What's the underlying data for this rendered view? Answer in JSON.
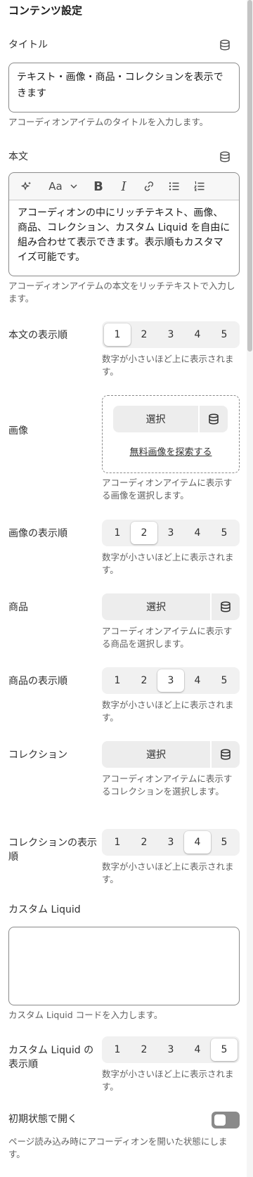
{
  "section_title": "コンテンツ設定",
  "title_field": {
    "label": "タイトル",
    "value": "テキスト・画像・商品・コレクションを表示できます",
    "help": "アコーディオンアイテムのタイトルを入力します。"
  },
  "body_field": {
    "label": "本文",
    "toolbar": {
      "font_label": "Aa",
      "bold": "B",
      "italic": "I"
    },
    "value": "アコーディオンの中にリッチテキスト、画像、商品、コレクション、カスタム Liquid を自由に組み合わせて表示できます。表示順もカスタマイズ可能です。",
    "help": "アコーディオンアイテムの本文をリッチテキストで入力します。"
  },
  "order_options": [
    "1",
    "2",
    "3",
    "4",
    "5"
  ],
  "order_help": "数字が小さいほど上に表示されます。",
  "body_order": {
    "label": "本文の表示順",
    "selected": "1"
  },
  "image": {
    "label": "画像",
    "select_label": "選択",
    "explore_link": "無料画像を探索する",
    "help": "アコーディオンアイテムに表示する画像を選択します。"
  },
  "image_order": {
    "label": "画像の表示順",
    "selected": "2"
  },
  "product": {
    "label": "商品",
    "select_label": "選択",
    "help": "アコーディオンアイテムに表示する商品を選択します。"
  },
  "product_order": {
    "label": "商品の表示順",
    "selected": "3"
  },
  "collection": {
    "label": "コレクション",
    "select_label": "選択",
    "help": "アコーディオンアイテムに表示するコレクションを選択します。"
  },
  "collection_order": {
    "label": "コレクションの表示順",
    "selected": "4"
  },
  "custom_liquid": {
    "label": "カスタム Liquid",
    "value": "",
    "help": "カスタム Liquid コードを入力します。"
  },
  "liquid_order": {
    "label": "カスタム Liquid の表示順",
    "selected": "5"
  },
  "open_default": {
    "label": "初期状態で開く",
    "checked": false,
    "help": "ページ読み込み時にアコーディオンを開いた状態にします。"
  },
  "icons": [
    "database-icon",
    "sparkle-icon",
    "chevron-down-icon",
    "link-icon",
    "bullet-list-icon",
    "numbered-list-icon"
  ],
  "colors": {
    "text": "#303030",
    "muted": "#616161",
    "segment_bg": "#f1f1f1",
    "toggle_off": "#8a8a8a"
  }
}
